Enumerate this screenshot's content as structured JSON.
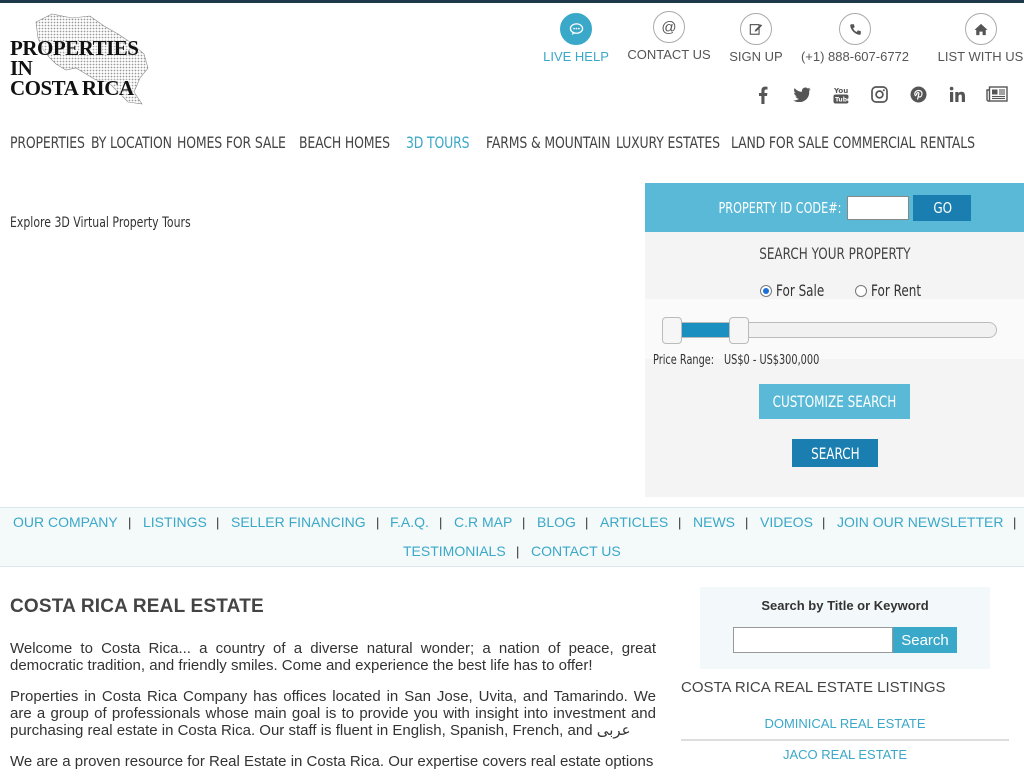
{
  "logo": {
    "line1": "PROPERTIES IN",
    "line2": "COSTA RICA"
  },
  "toplinks": [
    {
      "label": "LIVE HELP",
      "icon": "chat-icon"
    },
    {
      "label": "CONTACT US",
      "icon": "at-icon"
    },
    {
      "label": "SIGN UP",
      "icon": "edit-icon"
    },
    {
      "label": "(+1) 888-607-6772",
      "icon": "phone-icon"
    },
    {
      "label": "LIST WITH US",
      "icon": "home-icon"
    }
  ],
  "social": [
    "facebook-icon",
    "twitter-icon",
    "youtube-icon",
    "instagram-icon",
    "pinterest-icon",
    "linkedin-icon",
    "newspaper-icon"
  ],
  "nav": [
    "PROPERTIES",
    "BY LOCATION",
    "HOMES FOR SALE",
    "BEACH HOMES",
    "3D TOURS",
    "FARMS & MOUNTAIN",
    "LUXURY ESTATES",
    "LAND FOR SALE",
    "COMMERCIAL",
    "RENTALS"
  ],
  "explore": "Explore 3D Virtual Property Tours",
  "search": {
    "id_label": "PROPERTY ID CODE#:",
    "go": "GO",
    "heading": "SEARCH YOUR PROPERTY",
    "for_sale": "For Sale",
    "for_rent": "For Rent",
    "price_label": "Price Range:",
    "price_value": "US$0 - US$300,000",
    "customize": "CUSTOMIZE SEARCH",
    "search": "SEARCH"
  },
  "footnav": [
    "OUR COMPANY",
    "LISTINGS",
    "SELLER FINANCING",
    "F.A.Q.",
    "C.R MAP",
    "BLOG",
    "ARTICLES",
    "NEWS",
    "VIDEOS",
    "JOIN OUR NEWSLETTER",
    "TESTIMONIALS",
    "CONTACT US"
  ],
  "content": {
    "title": "COSTA RICA REAL ESTATE",
    "p1": "Welcome to Costa Rica... a country of a diverse natural wonder; a nation of peace, great democratic tradition, and friendly smiles. Come and experience the best life has to offer!",
    "p2": "Properties in Costa Rica Company has offices located in San Jose, Uvita, and Tamarindo. We are a group of professionals whose main goal is to provide you with insight into investment and purchasing real estate in Costa Rica. Our staff is fluent in English, Spanish, French, and عربى",
    "p3": "We are a proven resource for Real Estate in Costa Rica. Our expertise covers real estate options"
  },
  "keyword": {
    "title": "Search by Title or Keyword",
    "button": "Search"
  },
  "listings": {
    "heading": "COSTA RICA REAL ESTATE LISTINGS",
    "items": [
      "DOMINICAL REAL ESTATE",
      "JACO REAL ESTATE"
    ]
  },
  "colors": {
    "accent": "#3aa8c8",
    "dark_blue": "#1a7fb0",
    "topbar": "#1e3a4a"
  }
}
